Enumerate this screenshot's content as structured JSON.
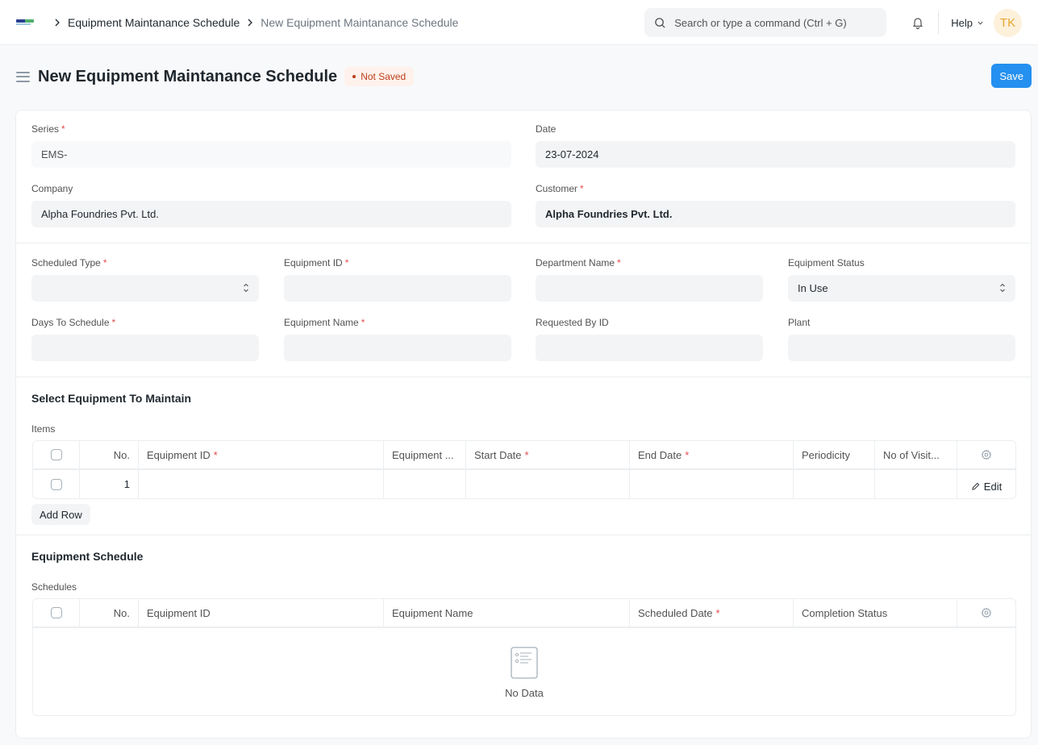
{
  "navbar": {
    "logo": "erpnext-logo",
    "breadcrumbs": [
      "Equipment Maintanance Schedule",
      "New Equipment Maintanance Schedule"
    ],
    "search_placeholder": "Search or type a command (Ctrl + G)",
    "help_label": "Help",
    "avatar_initials": "TK"
  },
  "page": {
    "title": "New Equipment Maintanance Schedule",
    "status_badge": "Not Saved",
    "save_label": "Save"
  },
  "section1": {
    "series": {
      "label": "Series",
      "required": "*",
      "value": "EMS-"
    },
    "date": {
      "label": "Date",
      "value": "23-07-2024"
    },
    "company": {
      "label": "Company",
      "value": "Alpha Foundries Pvt. Ltd."
    },
    "customer": {
      "label": "Customer",
      "required": "*",
      "value": "Alpha Foundries Pvt. Ltd."
    }
  },
  "section2": {
    "scheduled_type": {
      "label": "Scheduled Type",
      "required": "*",
      "value": ""
    },
    "equipment_id": {
      "label": "Equipment ID",
      "required": "*",
      "value": ""
    },
    "department_name": {
      "label": "Department Name",
      "required": "*",
      "value": ""
    },
    "equipment_status": {
      "label": "Equipment Status",
      "value": "In Use"
    },
    "days_to_schedule": {
      "label": "Days To Schedule",
      "required": "*",
      "value": ""
    },
    "equipment_name": {
      "label": "Equipment Name",
      "required": "*",
      "value": ""
    },
    "requested_by_id": {
      "label": "Requested By ID",
      "value": ""
    },
    "plant": {
      "label": "Plant",
      "value": ""
    }
  },
  "items_section": {
    "title": "Select Equipment To Maintain",
    "table_label": "Items",
    "columns": [
      "No.",
      "Equipment ID",
      "Equipment ...",
      "Start Date",
      "End Date",
      "Periodicity",
      "No of Visit..."
    ],
    "required": "*",
    "rows": [
      {
        "no": "1",
        "edit_label": "Edit"
      }
    ],
    "add_row_label": "Add Row"
  },
  "schedule_section": {
    "title": "Equipment Schedule",
    "table_label": "Schedules",
    "columns": [
      "No.",
      "Equipment ID",
      "Equipment Name",
      "Scheduled Date",
      "Completion Status"
    ],
    "required": "*",
    "empty_text": "No Data"
  }
}
